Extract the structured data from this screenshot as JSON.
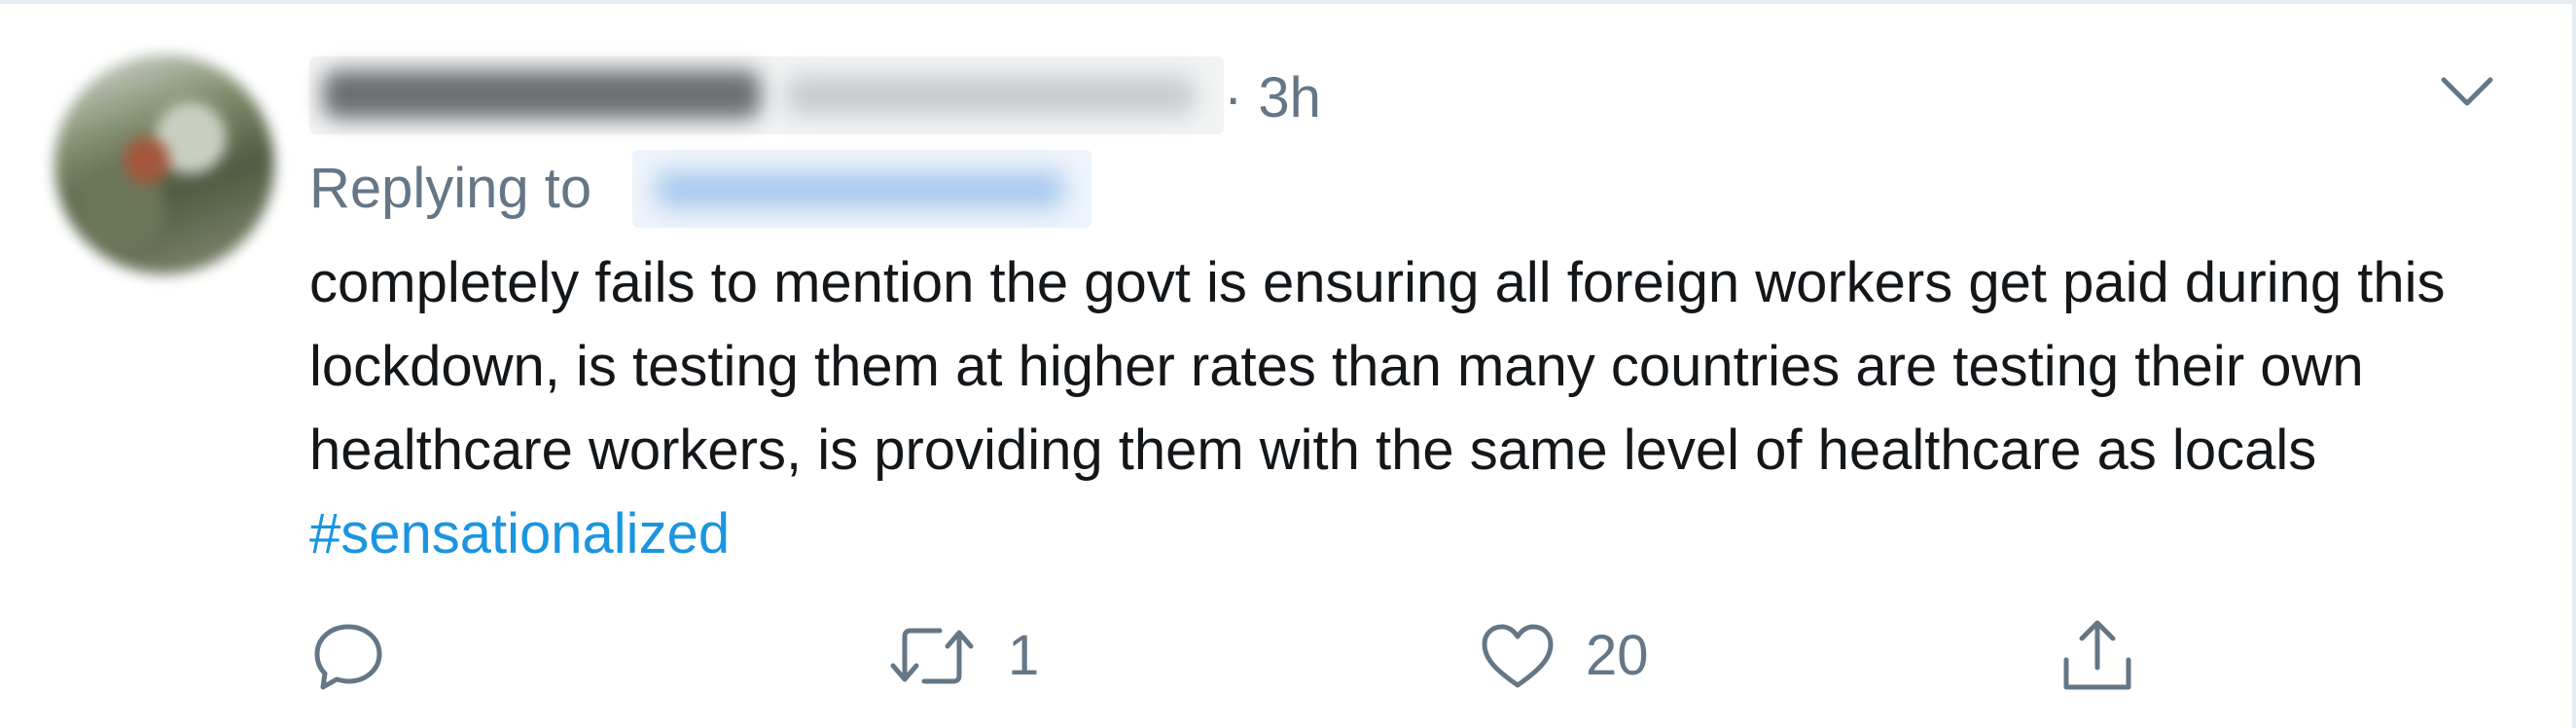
{
  "tweet": {
    "time": "· 3h",
    "replying_label": "Replying to",
    "body": "completely fails to mention the govt is ensuring all foreign workers get paid during this lockdown, is testing them at higher rates than many countries are testing their own  healthcare workers, is providing them with the same level of healthcare as locals",
    "hashtag": "#sensationalized",
    "actions": {
      "reply_icon": "reply-icon",
      "retweet_icon": "retweet-icon",
      "retweet_count": "1",
      "like_icon": "heart-icon",
      "like_count": "20",
      "share_icon": "share-icon"
    },
    "menu_icon": "chevron-down-icon"
  },
  "colors": {
    "text": "#14171a",
    "muted": "#657786",
    "link": "#1b95e0",
    "border": "#e6ecf0"
  }
}
